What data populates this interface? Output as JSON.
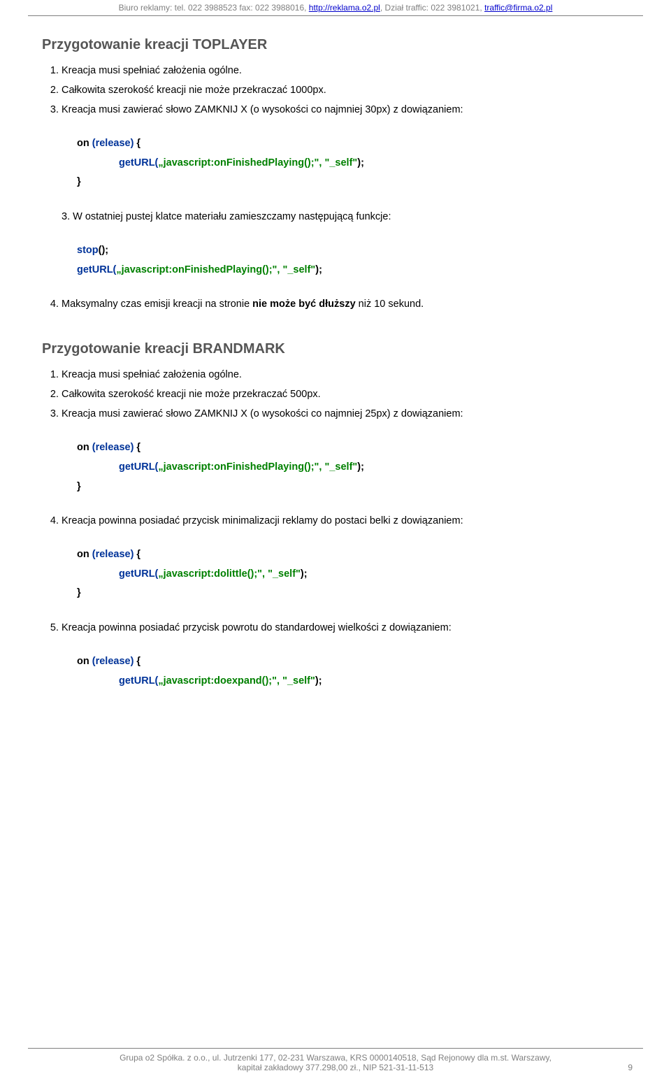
{
  "header": {
    "text_before": "Biuro reklamy: tel. 022 3988523 fax: 022 3988016, ",
    "link1": "http://reklama.o2.pl",
    "text_mid": ", Dział traffic: 022 3981021, ",
    "link2": "traffic@firma.o2.pl"
  },
  "section1": {
    "title": "Przygotowanie kreacji TOPLAYER",
    "item1": "Kreacja musi spełniać założenia ogólne.",
    "item2": "Całkowita szerokość kreacji nie może przekraczać 1000px.",
    "item3": "Kreacja musi zawierać słowo ZAMKNIJ X (o wysokości co najmniej 30px) z dowiązaniem:",
    "code1": {
      "l1_on": "on ",
      "l1_release": "(release)",
      "l1_brace": " {",
      "l2_fn": "getURL(",
      "l2_arg": "„javascript:onFinishedPlaying();\", \"_self\"",
      "l2_close": ");",
      "l3": "}"
    },
    "sub3_label": "3.",
    "sub3_text": "W ostatniej pustej klatce materiału zamieszczamy następującą funkcje:",
    "code2": {
      "l1_fn": "stop",
      "l1_close": "();",
      "l2_fn": "getURL(",
      "l2_arg": "„javascript:onFinishedPlaying();\", \"_self\"",
      "l2_close": ");"
    },
    "item4_pre": "Maksymalny czas emisji kreacji na stronie ",
    "item4_bold": "nie może być dłuższy",
    "item4_post": " niż 10 sekund."
  },
  "section2": {
    "title": "Przygotowanie kreacji BRANDMARK",
    "item1": "Kreacja musi spełniać założenia ogólne.",
    "item2": "Całkowita szerokość kreacji nie może przekraczać 500px.",
    "item3": "Kreacja musi zawierać słowo ZAMKNIJ X (o wysokości co najmniej 25px) z dowiązaniem:",
    "code1": {
      "l1_on": "on ",
      "l1_release": "(release)",
      "l1_brace": " {",
      "l2_fn": "getURL(",
      "l2_arg": "„javascript:onFinishedPlaying();\", \"_self\"",
      "l2_close": ");",
      "l3": "}"
    },
    "item4": "Kreacja powinna posiadać przycisk minimalizacji reklamy do postaci belki z dowiązaniem:",
    "code2": {
      "l1_on": "on ",
      "l1_release": "(release)",
      "l1_brace": " {",
      "l2_fn": "getURL(",
      "l2_arg": "„javascript:dolittle();\", \"_self\"",
      "l2_close": ");",
      "l3": "}"
    },
    "item5": "Kreacja powinna posiadać przycisk powrotu do standardowej wielkości z dowiązaniem:",
    "code3": {
      "l1_on": "on ",
      "l1_release": "(release)",
      "l1_brace": " {",
      "l2_fn": "getURL(",
      "l2_arg": "„javascript:doexpand();\", \"_self\"",
      "l2_close": ");"
    }
  },
  "footer": {
    "line1": "Grupa o2 Spółka. z o.o., ul. Jutrzenki 177, 02-231 Warszawa, KRS 0000140518, Sąd Rejonowy dla m.st. Warszawy,",
    "line2": "kapitał zakładowy 377.298,00 zł., NIP 521-31-11-513",
    "page": "9"
  }
}
